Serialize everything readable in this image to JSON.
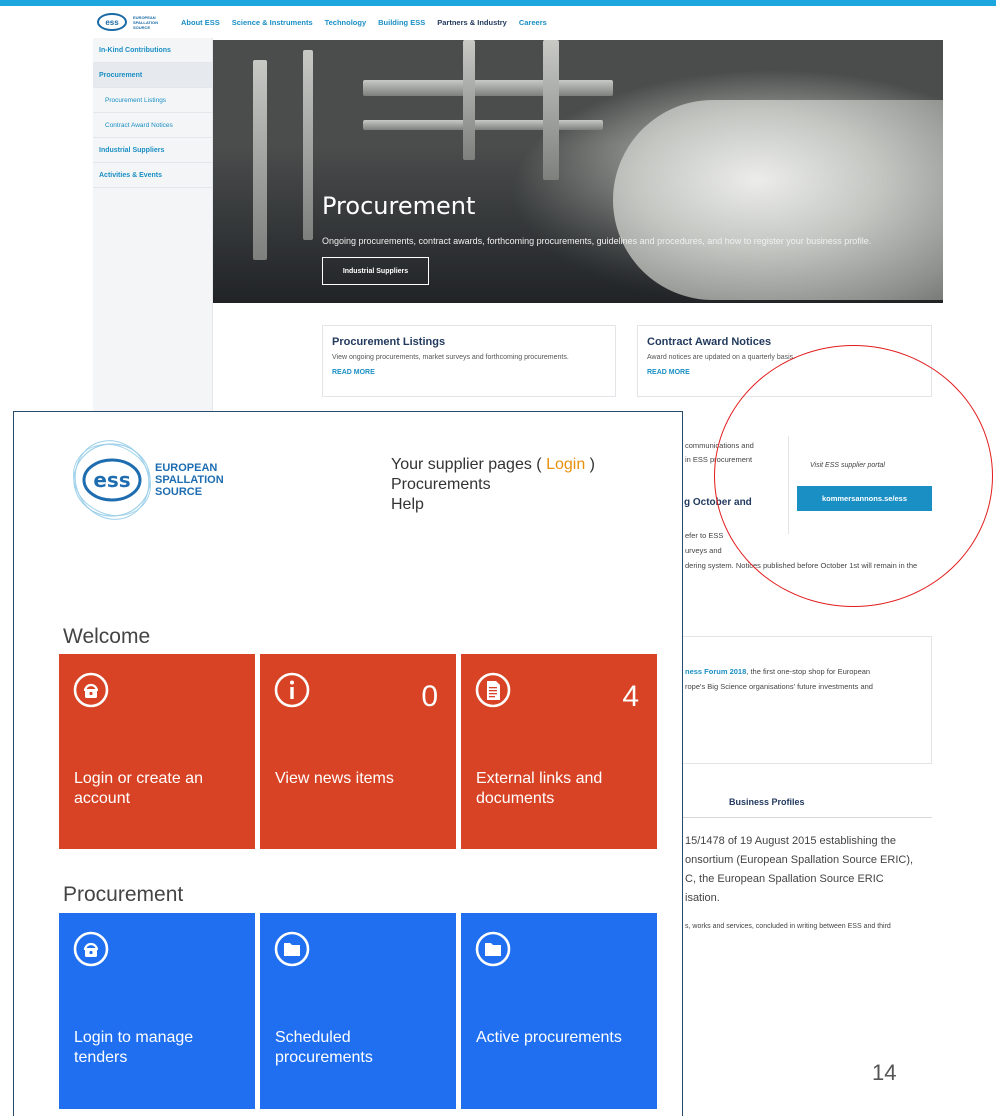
{
  "website": {
    "nav": {
      "logo_mark": "ess",
      "logo_text": "EUROPEAN SPALLATION SOURCE",
      "links": [
        "About ESS",
        "Science & Instruments",
        "Technology",
        "Building ESS",
        "Partners & Industry",
        "Careers"
      ]
    },
    "sidebar": {
      "items": [
        "In-Kind Contributions",
        "Procurement",
        "Procurement Listings",
        "Contract Award Notices",
        "Industrial Suppliers",
        "Activities & Events"
      ]
    },
    "hero": {
      "title": "Procurement",
      "subtitle": "Ongoing procurements, contract awards, forthcoming procurements, guidelines and procedures, and how to register your business profile.",
      "button": "Industrial Suppliers"
    },
    "cards": [
      {
        "title": "Procurement Listings",
        "text": "View ongoing procurements, market surveys and forthcoming procurements.",
        "link": "READ MORE"
      },
      {
        "title": "Contract Award Notices",
        "text": "Award notices are updated on a quarterly basis.",
        "link": "READ MORE"
      }
    ],
    "fragments": {
      "f1": "communications and",
      "f2": "in ESS procurement",
      "f3": "g October and",
      "f4": "efer to ESS",
      "f5": "urveys and",
      "f6": "dering system. Notices published before October 1st will remain in the",
      "f7": "ness Forum 2018",
      "f7b": ", the first one-stop shop for European",
      "f8": "rope's Big Science organisations' future investments and",
      "f9": "15/1478 of 19 August 2015 establishing the",
      "f10": "onsortium (European Spallation Source ERIC),",
      "f11": "C, the European Spallation Source ERIC",
      "f12": "isation.",
      "f13": "s, works and services, concluded in writing between ESS and third"
    },
    "portal_label": "Visit ESS supplier portal",
    "portal_button": "kommersannons.se/ess",
    "business_profiles": "Business Profiles",
    "page_number": "14"
  },
  "portal": {
    "logo_text": [
      "EUROPEAN",
      "SPALLATION",
      "SOURCE"
    ],
    "links": {
      "supplier_prefix": "Your supplier pages ( ",
      "login": "Login",
      "supplier_suffix": " )",
      "procurements": "Procurements",
      "help": "Help"
    },
    "welcome": {
      "title": "Welcome",
      "tiles": [
        {
          "label": "Login or create an account",
          "count": "",
          "icon": "lock-icon"
        },
        {
          "label": "View news items",
          "count": "0",
          "icon": "info-icon"
        },
        {
          "label": "External links and documents",
          "count": "4",
          "icon": "document-icon"
        }
      ]
    },
    "procurement": {
      "title": "Procurement",
      "tiles": [
        {
          "label": "Login to manage tenders",
          "icon": "lock-icon"
        },
        {
          "label": "Scheduled procurements",
          "icon": "folder-icon"
        },
        {
          "label": "Active procurements",
          "icon": "folder-icon"
        }
      ]
    },
    "colors": {
      "orange_tile": "#d74324",
      "blue_tile": "#1f6ff0",
      "login_link": "#e8900c"
    }
  }
}
